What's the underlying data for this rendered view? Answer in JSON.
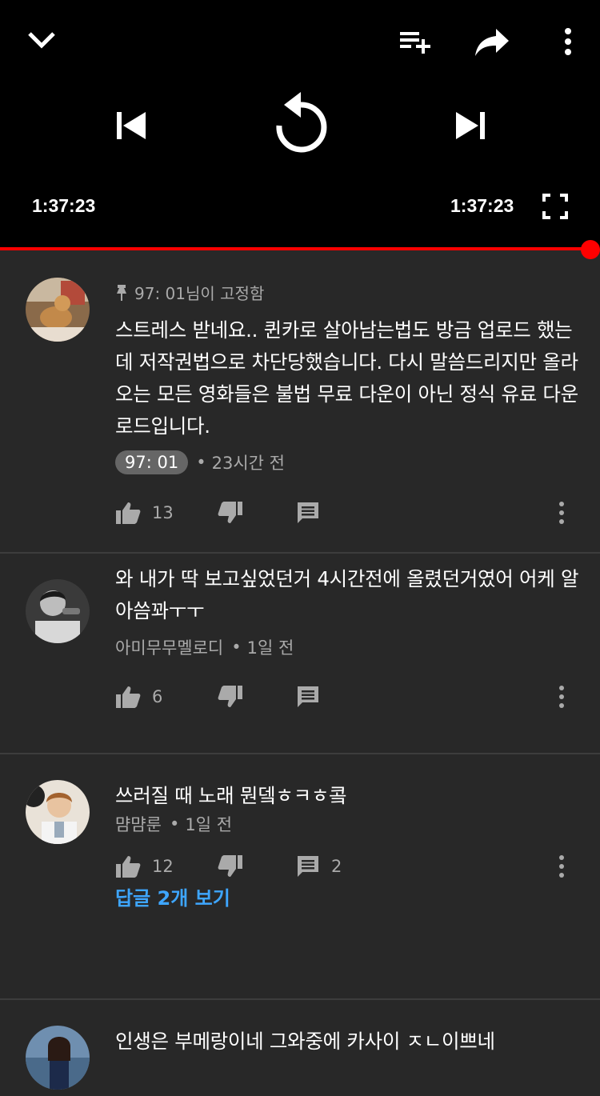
{
  "player": {
    "elapsed": "1:37:23",
    "duration": "1:37:23",
    "progress_fraction": 1.0,
    "accent_color": "#ff0000",
    "icons": [
      "chevron-down-icon",
      "add-to-playlist-icon",
      "share-icon",
      "more-vert-icon",
      "previous-icon",
      "replay-icon",
      "next-icon",
      "fullscreen-icon"
    ]
  },
  "comments": [
    {
      "pinned_label": "97: 01님이 고정함",
      "text": "스트레스 받네요.. 퀸카로 살아남는법도 방금 업로드 했는데 저작권법으로 차단당했습니다. 다시 말씀드리지만 올라오는 모든 영화들은 불법 무료 다운이 아닌 정식 유료 다운로드입니다.",
      "author": "97: 01",
      "time": "23시간 전",
      "likes": "13",
      "replies_count": ""
    },
    {
      "text": "와 내가 딱 보고싶었던거 4시간전에 올렸던거였어 어케 알아씀꽈ㅜㅜ",
      "author": "아미무무멜로디",
      "time": "1일 전",
      "likes": "6",
      "replies_count": ""
    },
    {
      "text": "쓰러질 때 노래 뭔뎈ㅎㅋㅎ콬",
      "author": "먐먐룬",
      "time": "1일 전",
      "likes": "12",
      "replies_count": "2",
      "view_replies": "답글 2개 보기"
    },
    {
      "text": "인생은 부메랑이네 그와중에 카사이 ㅈㄴ이쁘네"
    }
  ],
  "separator": "•"
}
